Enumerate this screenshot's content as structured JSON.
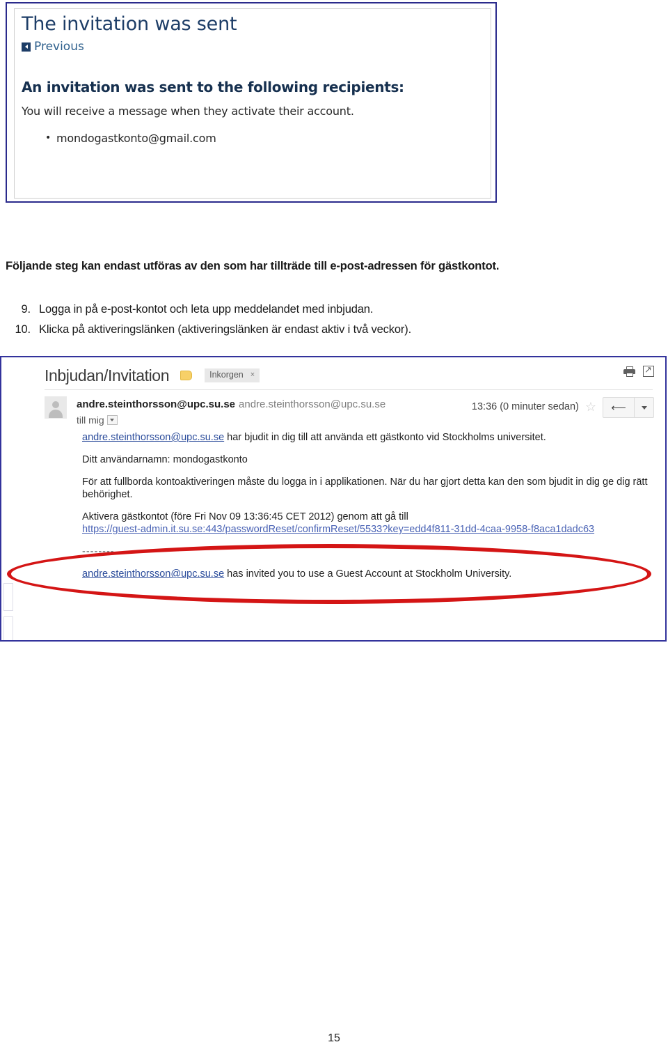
{
  "document": {
    "page_number": "15",
    "intro_paragraph": "Följande steg kan endast utföras av den som har tillträde till e-post-adressen för gästkontot.",
    "steps": [
      {
        "number": "9.",
        "text": "Logga in på e-post-kontot och leta upp meddelandet med inbjudan."
      },
      {
        "number": "10.",
        "text": "Klicka på aktiveringslänken (aktiveringslänken är endast aktiv i två veckor)."
      }
    ]
  },
  "invitation_panel": {
    "title": "The invitation was sent",
    "previous_link": "Previous",
    "previous_icon": "triangle-left-icon",
    "subheading": "An invitation was sent to the following recipients:",
    "note": "You will receive a message when they activate their account.",
    "recipients": [
      "mondogastkonto@gmail.com"
    ],
    "border_color": "#2a2a8c"
  },
  "email_client": {
    "subject": "Inbjudan/Invitation",
    "label_icon": "label-tag-icon",
    "label_color": "#f7d068",
    "folder_chip": "Inkorgen",
    "folder_chip_close": "×",
    "top_icons": [
      {
        "name": "print-icon"
      },
      {
        "name": "popout-window-icon"
      }
    ],
    "avatar_icon": "user-avatar-icon",
    "sender_name": "andre.steinthorsson@upc.su.se",
    "sender_address": "andre.steinthorsson@upc.su.se",
    "to_line": "till mig",
    "to_dropdown_icon": "chevron-down-icon",
    "timestamp": "13:36 (0 minuter sedan)",
    "star_icon": "star-outline-icon",
    "reply_icon": "reply-arrow-icon",
    "more_icon": "chevron-down-icon",
    "body": {
      "line1_link": "andre.steinthorsson@upc.su.se",
      "line1_rest": " har bjudit in dig till att använda ett gästkonto vid Stockholms universitet.",
      "username_line": "Ditt användarnamn: mondogastkonto",
      "activation_note": "För att fullborda kontoaktiveringen måste du logga in i applikationen. När du har gjort detta kan den som bjudit in dig ge dig rätt behörighet.",
      "activate_line": "Aktivera gästkontot (före Fri Nov 09 13:36:45 CET 2012) genom att gå till",
      "activation_url": "https://guest-admin.it.su.se:443/passwordReset/confirmReset/5533?key=edd4f811-31dd-4caa-9958-f8aca1dadc63",
      "separator": "--------",
      "footer_link": "andre.steinthorsson@upc.su.se",
      "footer_rest": " has invited you to use a Guest Account at Stockholm University."
    },
    "annotation": {
      "shape": "ellipse",
      "color": "#d41515"
    },
    "border_color": "#33339c"
  }
}
